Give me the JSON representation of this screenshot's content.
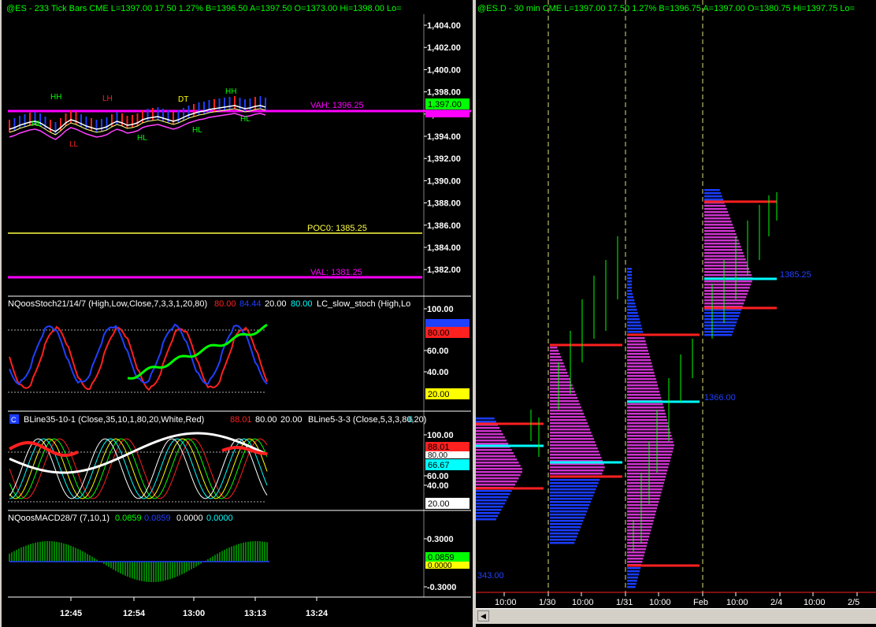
{
  "left": {
    "header": "@ES - 233 Tick Bars  CME  L=1397.00  17.50  1.27%  B=1396.50  A=1397.50  O=1373.00  Hi=1398.00  Lo=",
    "price_axis": [
      "1,404.00",
      "1,402.00",
      "1,400.00",
      "1,398.00",
      "1,396.00",
      "1,394.00",
      "1,392.00",
      "1,390.00",
      "1,388.00",
      "1,386.00",
      "1,384.00",
      "1,382.00"
    ],
    "price_marker": "1,397.00",
    "vah_label": "VAH: 1396.25",
    "poc_label": "POC0: 1385.25",
    "val_label": "VAL: 1381.25",
    "swing_labels": [
      {
        "text": "HH",
        "color": "#00ff00"
      },
      {
        "text": "HL",
        "color": "#00ff00"
      },
      {
        "text": "LL",
        "color": "#ff2020"
      },
      {
        "text": "LH",
        "color": "#ff2020"
      },
      {
        "text": "HL",
        "color": "#00ff00"
      },
      {
        "text": "DT",
        "color": "#ffff00"
      },
      {
        "text": "HL",
        "color": "#00ff00"
      },
      {
        "text": "HH",
        "color": "#00ff00"
      },
      {
        "text": "HL",
        "color": "#00ff00"
      }
    ],
    "stoch": {
      "title": "NQoosStoch21/14/7 (High,Low,Close,7,3,3,1,20,80)",
      "v1": "80.00",
      "v2": "84.44",
      "v3": "20.00",
      "v4": "80.00",
      "title2": "LC_slow_stoch (High,Lo",
      "axis": [
        "100.00",
        "60.00",
        "40.00"
      ],
      "marker_high": "80.00",
      "marker_low": "20.00"
    },
    "bline": {
      "box": "C",
      "title": "BLine35-10-1 (Close,35,10,1,80,20,White,Red)",
      "v1": "88.01",
      "v2": "80.00",
      "v3": "20.00",
      "title2": "BLine5-3-3 (Close,5,3,3,80,20)",
      "tail": "6",
      "axis": [
        "100.00",
        "60.00",
        "40.00"
      ],
      "marker_a": "88.01",
      "marker_b": "80.00",
      "marker_c": "66.67",
      "marker_d": "20.00"
    },
    "macd": {
      "title": "NQoosMACD28/7 (7,10,1)",
      "v1": "0.0859",
      "v2": "0.0859",
      "v3": "0.0000",
      "v4": "0.0000",
      "axis": [
        "0.3000",
        "-0.3000"
      ],
      "marker_a": "0.0859",
      "marker_b": "0.0000"
    },
    "time_axis": [
      "12:45",
      "12:54",
      "13:00",
      "13:13",
      "13:24"
    ]
  },
  "right": {
    "header": "@ES.D - 30 min  CME  L=1397.00  17.50  1.27%  B=1396.75  A=1397.00  O=1380.75  Hi=1397.75  Lo=",
    "poc_label_1": "1385.25",
    "poc_label_2": "1366.00",
    "poc_label_3": "343.00",
    "time_axis": [
      "10:00",
      "1/30",
      "10:00",
      "1/31",
      "10:00",
      "Feb",
      "10:00",
      "2/4",
      "10:00",
      "2/5"
    ]
  },
  "colors": {
    "magenta": "#ff00ff",
    "cyan": "#00ffff",
    "red": "#ff2020",
    "green": "#00ff00",
    "blue": "#2040ff",
    "yellow": "#ffff00",
    "profile": "#cc33cc",
    "tpo": "#1a3cff"
  }
}
